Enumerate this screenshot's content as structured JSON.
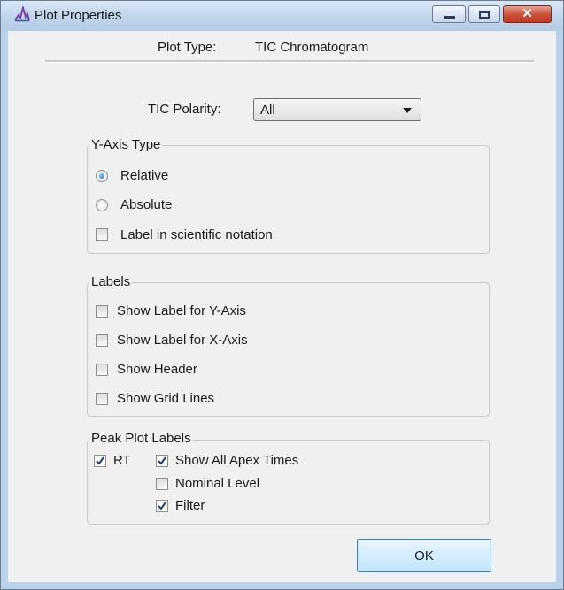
{
  "window": {
    "title": "Plot Properties",
    "controls": {
      "minimize": "minimize",
      "maximize": "maximize",
      "close": "close"
    }
  },
  "plot_type": {
    "label": "Plot Type:",
    "value": "TIC Chromatogram"
  },
  "tic_polarity": {
    "label": "TIC Polarity:",
    "selected": "All"
  },
  "y_axis_type": {
    "title": "Y-Axis Type",
    "relative": {
      "label": "Relative",
      "checked": true
    },
    "absolute": {
      "label": "Absolute",
      "checked": false
    },
    "scientific": {
      "label": "Label in scientific notation",
      "checked": false
    }
  },
  "labels": {
    "title": "Labels",
    "items": [
      {
        "label": "Show Label for Y-Axis",
        "checked": false
      },
      {
        "label": "Show Label for X-Axis",
        "checked": false
      },
      {
        "label": "Show Header",
        "checked": false
      },
      {
        "label": "Show Grid Lines",
        "checked": false
      }
    ]
  },
  "peak_plot_labels": {
    "title": "Peak Plot Labels",
    "rt": {
      "label": "RT",
      "checked": true
    },
    "show_all_apex": {
      "label": "Show All Apex Times",
      "checked": true
    },
    "nominal_level": {
      "label": "Nominal Level",
      "checked": false
    },
    "filter": {
      "label": "Filter",
      "checked": true
    }
  },
  "buttons": {
    "ok": "OK"
  },
  "colors": {
    "title_bar": "#c3d7ee",
    "close_button": "#c94f38",
    "radio_selected": "#1a6fc4",
    "ok_border": "#3c7fb1"
  },
  "icons": {
    "app": "chromatogram-peak-icon",
    "check": "checkmark-icon"
  }
}
